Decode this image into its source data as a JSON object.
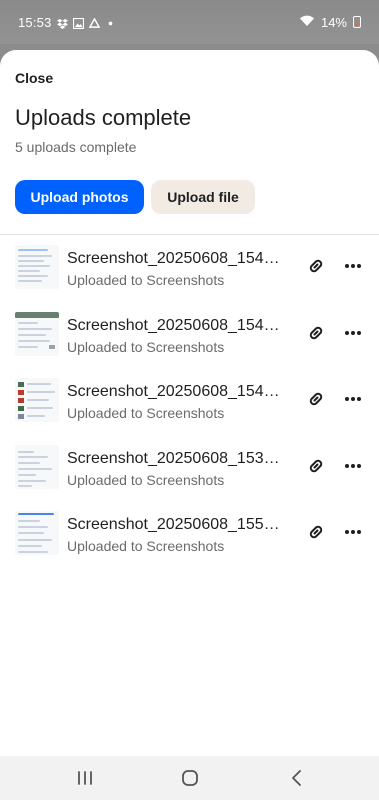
{
  "status_bar": {
    "time": "15:53",
    "battery_text": "14%",
    "icons": [
      "dropbox-icon",
      "image-icon",
      "google-one-icon",
      "dot-icon",
      "wifi-icon",
      "battery-icon"
    ]
  },
  "sheet": {
    "close_label": "Close",
    "title": "Uploads complete",
    "subtitle": "5 uploads complete",
    "upload_photos_label": "Upload photos",
    "upload_file_label": "Upload file"
  },
  "uploads": [
    {
      "name": "Screenshot_20250608_154…",
      "status": "Uploaded to Screenshots"
    },
    {
      "name": "Screenshot_20250608_154…",
      "status": "Uploaded to Screenshots"
    },
    {
      "name": "Screenshot_20250608_154…",
      "status": "Uploaded to Screenshots"
    },
    {
      "name": "Screenshot_20250608_153…",
      "status": "Uploaded to Screenshots"
    },
    {
      "name": "Screenshot_20250608_155…",
      "status": "Uploaded to Screenshots"
    }
  ],
  "row_icons": {
    "link": "link-icon",
    "more": "more-options-icon"
  },
  "nav_bar": {
    "icons": [
      "recent-apps-icon",
      "home-icon",
      "back-icon"
    ]
  },
  "colors": {
    "primary": "#0061fe",
    "secondary_button": "#f1ebe4",
    "text": "#1f1f1f",
    "muted_text": "#6b6b6b",
    "scrim": "#8c8c8c"
  }
}
